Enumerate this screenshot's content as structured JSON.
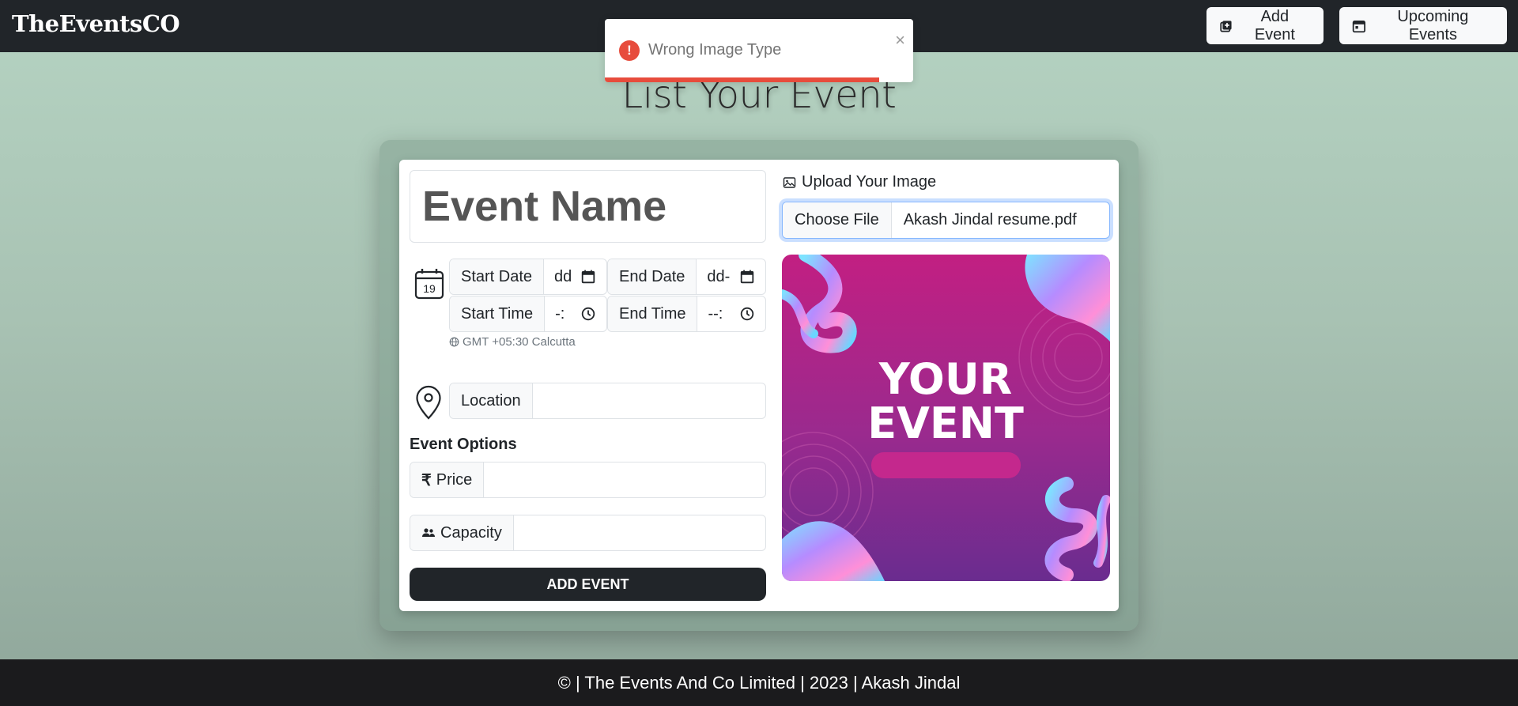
{
  "navbar": {
    "brand": "TheEventsCO",
    "add_event_label": "Add Event",
    "upcoming_events_label": "Upcoming Events"
  },
  "toast": {
    "message": "Wrong Image Type",
    "close_symbol": "×",
    "icon_symbol": "!",
    "progress_remaining": 0.89,
    "accent_color": "#e74c3c"
  },
  "page": {
    "title": "List Your Event"
  },
  "form": {
    "event_name_placeholder": "Event Name",
    "calendar_day": "19",
    "start_date_label": "Start Date",
    "start_date_value": "dd",
    "end_date_label": "End Date",
    "end_date_value": "dd-",
    "start_time_label": "Start Time",
    "start_time_value": "-:",
    "end_time_label": "End Time",
    "end_time_value": "--:",
    "timezone": "GMT +05:30 Calcutta",
    "location_label": "Location",
    "location_value": "",
    "options_title": "Event Options",
    "price_label": "Price",
    "price_symbol": "₹",
    "price_value": "",
    "capacity_label": "Capacity",
    "capacity_value": "",
    "submit_label": "ADD EVENT"
  },
  "upload": {
    "label": "Upload Your Image",
    "choose_file_label": "Choose File",
    "file_name": "Akash Jindal resume.pdf",
    "preview_text_line1": "YOUR",
    "preview_text_line2": "EVENT"
  },
  "footer": {
    "text": "© | The Events And Co Limited | 2023 | Akash Jindal"
  },
  "colors": {
    "navbar_bg": "#212529",
    "footer_bg": "#1b1b1d",
    "toast_accent": "#e74c3c",
    "submit_bg": "#212529",
    "preview_magenta": "#b4247e"
  }
}
